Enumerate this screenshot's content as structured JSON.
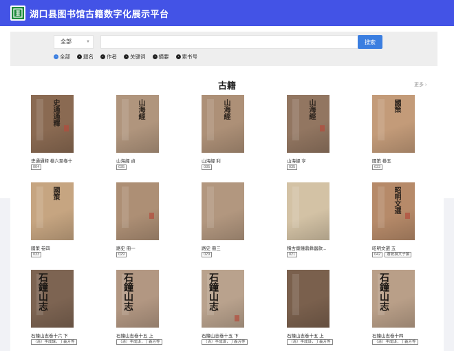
{
  "site": {
    "title": "湖口县图书馆古籍数字化展示平台",
    "logo_icon": "library-seal-icon"
  },
  "search": {
    "select_value": "全部",
    "input_value": "",
    "button_label": "搜索",
    "filters": [
      {
        "label": "全部",
        "selected": true
      },
      {
        "label": "题名",
        "selected": false
      },
      {
        "label": "作者",
        "selected": false
      },
      {
        "label": "关键词",
        "selected": false
      },
      {
        "label": "摘要",
        "selected": false
      },
      {
        "label": "索书号",
        "selected": false
      }
    ]
  },
  "section": {
    "title": "古籍",
    "more": "更多 ›"
  },
  "books": [
    {
      "title": "史通通释 卷六至卷十",
      "tags": [
        "004"
      ],
      "cover": "#8a6a52",
      "text": "史通通釋",
      "accent": "#2a221c"
    },
    {
      "title": "山海經 貞",
      "tags": [
        "035"
      ],
      "cover": "#b0957d",
      "text": "山海經",
      "accent": "#2a221c"
    },
    {
      "title": "山海經 利",
      "tags": [
        "035"
      ],
      "cover": "#ad9077",
      "text": "山海經",
      "accent": "#2a221c"
    },
    {
      "title": "山海經 亨",
      "tags": [
        "035"
      ],
      "cover": "#927661",
      "text": "山海經",
      "accent": "#2a221c"
    },
    {
      "title": "國策 卷五",
      "tags": [
        "033"
      ],
      "cover": "#c39b79",
      "text": "國策",
      "accent": "#2a221c"
    },
    {
      "title": "國策 卷四",
      "tags": [
        "033"
      ],
      "cover": "#c6a581",
      "text": "國策",
      "accent": "#2a221c"
    },
    {
      "title": "路史 冊一",
      "tags": [
        "029"
      ],
      "cover": "#ad8f75",
      "text": "",
      "accent": "#2a221c"
    },
    {
      "title": "路史 冊三",
      "tags": [
        "029"
      ],
      "cover": "#b2977f",
      "text": "",
      "accent": "#2a221c"
    },
    {
      "title": "積古齋鐘鼎彝器款...",
      "tags": [
        "021"
      ],
      "cover": "#d3c2a5",
      "text": "",
      "accent": "#2a221c"
    },
    {
      "title": "昭明文選 五",
      "tags": [
        "042",
        "蕭統撰文子撰"
      ],
      "cover": "#b68a69",
      "text": "昭明文選",
      "accent": "#2a221c"
    },
    {
      "title": "石鐘山志卷十六 下",
      "tags": [
        "（清）李成謀，丁義芳等"
      ],
      "cover": "#7d6452",
      "text": "石鐘山志",
      "accent": "#1a1613"
    },
    {
      "title": "石鐘山志卷十五 上",
      "tags": [
        "（清）李成谋，丁義芳等"
      ],
      "cover": "#b29782",
      "text": "石鐘山志",
      "accent": "#1a1613"
    },
    {
      "title": "石鐘山志卷十五 下",
      "tags": [
        "（清）李成谋，丁義芳等"
      ],
      "cover": "#b9a28d",
      "text": "石鐘山志",
      "accent": "#1a1613"
    },
    {
      "title": "石鐘山志卷十五 上",
      "tags": [
        "（清）李成谋，丁義芳等"
      ],
      "cover": "#7a604d",
      "text": "",
      "accent": "#1a1613"
    },
    {
      "title": "石鐘山志卷十四",
      "tags": [
        "（清）李成谋，丁義芳等"
      ],
      "cover": "#b99f88",
      "text": "石鐘山志",
      "accent": "#1a1613"
    }
  ]
}
